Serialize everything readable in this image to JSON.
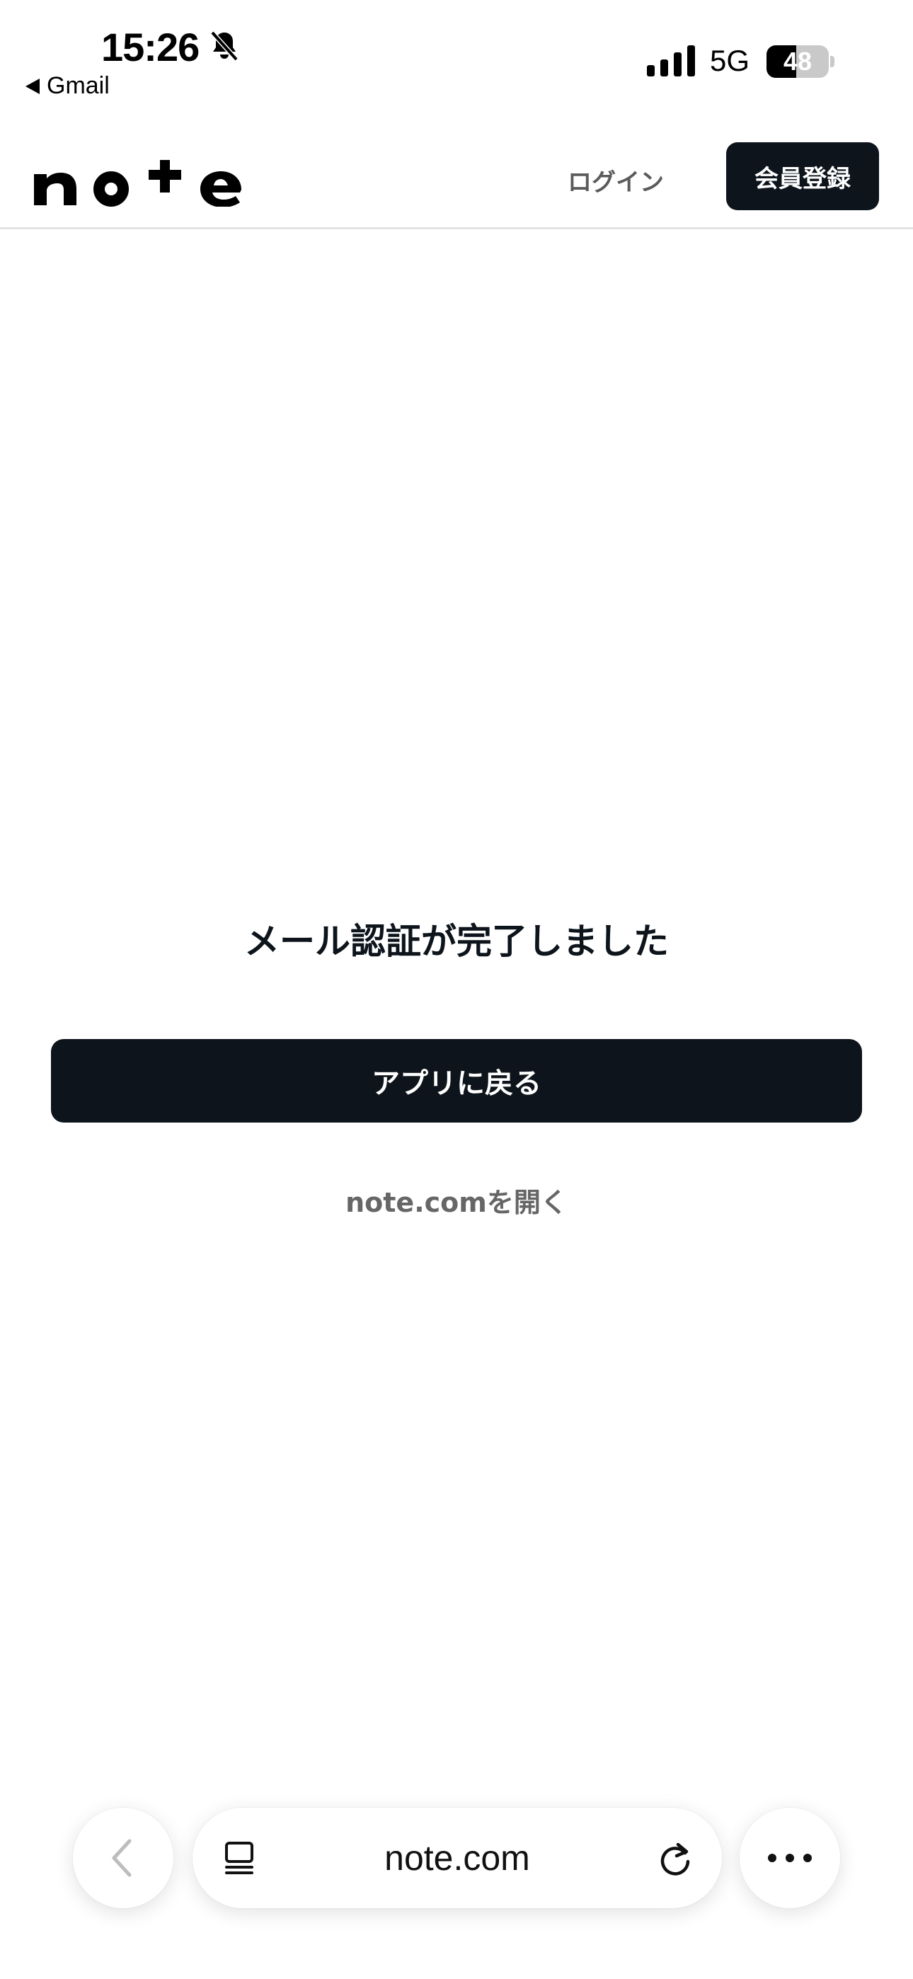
{
  "status_bar": {
    "time": "15:26",
    "back_app": "Gmail",
    "network": "5G",
    "battery_level": "48",
    "battery_fraction": 0.48,
    "icons": [
      "bell-slash-icon",
      "signal-icon"
    ]
  },
  "header": {
    "logo_text": "note",
    "login_label": "ログイン",
    "signup_label": "会員登録"
  },
  "main": {
    "message": "メール認証が完了しました",
    "app_button_label": "アプリに戻る",
    "open_link_label": "note.comを開く"
  },
  "browser": {
    "url": "note.com",
    "icons": [
      "chevron-left-icon",
      "tab-overview-icon",
      "reload-icon",
      "more-icon"
    ]
  },
  "colors": {
    "primary": "#0d141b",
    "muted_text": "#666666",
    "divider": "#e3e3e3"
  }
}
